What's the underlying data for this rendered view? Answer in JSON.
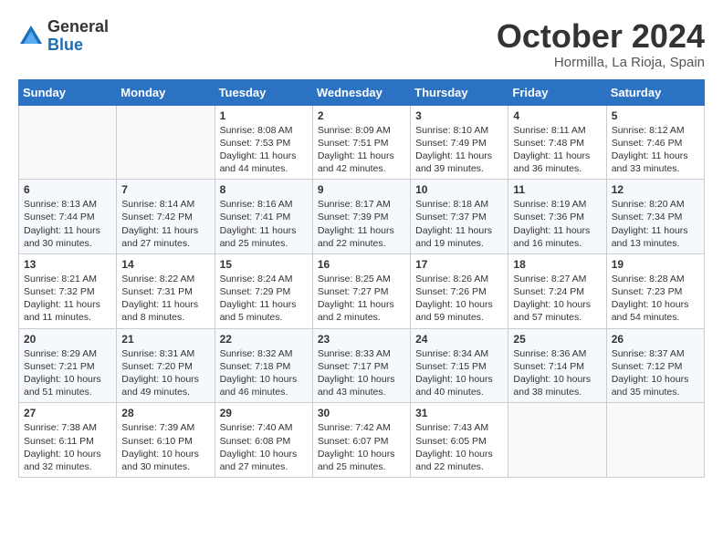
{
  "header": {
    "logo_general": "General",
    "logo_blue": "Blue",
    "month_title": "October 2024",
    "location": "Hormilla, La Rioja, Spain"
  },
  "days_of_week": [
    "Sunday",
    "Monday",
    "Tuesday",
    "Wednesday",
    "Thursday",
    "Friday",
    "Saturday"
  ],
  "weeks": [
    [
      {
        "day": "",
        "info": ""
      },
      {
        "day": "",
        "info": ""
      },
      {
        "day": "1",
        "info": "Sunrise: 8:08 AM\nSunset: 7:53 PM\nDaylight: 11 hours and 44 minutes."
      },
      {
        "day": "2",
        "info": "Sunrise: 8:09 AM\nSunset: 7:51 PM\nDaylight: 11 hours and 42 minutes."
      },
      {
        "day": "3",
        "info": "Sunrise: 8:10 AM\nSunset: 7:49 PM\nDaylight: 11 hours and 39 minutes."
      },
      {
        "day": "4",
        "info": "Sunrise: 8:11 AM\nSunset: 7:48 PM\nDaylight: 11 hours and 36 minutes."
      },
      {
        "day": "5",
        "info": "Sunrise: 8:12 AM\nSunset: 7:46 PM\nDaylight: 11 hours and 33 minutes."
      }
    ],
    [
      {
        "day": "6",
        "info": "Sunrise: 8:13 AM\nSunset: 7:44 PM\nDaylight: 11 hours and 30 minutes."
      },
      {
        "day": "7",
        "info": "Sunrise: 8:14 AM\nSunset: 7:42 PM\nDaylight: 11 hours and 27 minutes."
      },
      {
        "day": "8",
        "info": "Sunrise: 8:16 AM\nSunset: 7:41 PM\nDaylight: 11 hours and 25 minutes."
      },
      {
        "day": "9",
        "info": "Sunrise: 8:17 AM\nSunset: 7:39 PM\nDaylight: 11 hours and 22 minutes."
      },
      {
        "day": "10",
        "info": "Sunrise: 8:18 AM\nSunset: 7:37 PM\nDaylight: 11 hours and 19 minutes."
      },
      {
        "day": "11",
        "info": "Sunrise: 8:19 AM\nSunset: 7:36 PM\nDaylight: 11 hours and 16 minutes."
      },
      {
        "day": "12",
        "info": "Sunrise: 8:20 AM\nSunset: 7:34 PM\nDaylight: 11 hours and 13 minutes."
      }
    ],
    [
      {
        "day": "13",
        "info": "Sunrise: 8:21 AM\nSunset: 7:32 PM\nDaylight: 11 hours and 11 minutes."
      },
      {
        "day": "14",
        "info": "Sunrise: 8:22 AM\nSunset: 7:31 PM\nDaylight: 11 hours and 8 minutes."
      },
      {
        "day": "15",
        "info": "Sunrise: 8:24 AM\nSunset: 7:29 PM\nDaylight: 11 hours and 5 minutes."
      },
      {
        "day": "16",
        "info": "Sunrise: 8:25 AM\nSunset: 7:27 PM\nDaylight: 11 hours and 2 minutes."
      },
      {
        "day": "17",
        "info": "Sunrise: 8:26 AM\nSunset: 7:26 PM\nDaylight: 10 hours and 59 minutes."
      },
      {
        "day": "18",
        "info": "Sunrise: 8:27 AM\nSunset: 7:24 PM\nDaylight: 10 hours and 57 minutes."
      },
      {
        "day": "19",
        "info": "Sunrise: 8:28 AM\nSunset: 7:23 PM\nDaylight: 10 hours and 54 minutes."
      }
    ],
    [
      {
        "day": "20",
        "info": "Sunrise: 8:29 AM\nSunset: 7:21 PM\nDaylight: 10 hours and 51 minutes."
      },
      {
        "day": "21",
        "info": "Sunrise: 8:31 AM\nSunset: 7:20 PM\nDaylight: 10 hours and 49 minutes."
      },
      {
        "day": "22",
        "info": "Sunrise: 8:32 AM\nSunset: 7:18 PM\nDaylight: 10 hours and 46 minutes."
      },
      {
        "day": "23",
        "info": "Sunrise: 8:33 AM\nSunset: 7:17 PM\nDaylight: 10 hours and 43 minutes."
      },
      {
        "day": "24",
        "info": "Sunrise: 8:34 AM\nSunset: 7:15 PM\nDaylight: 10 hours and 40 minutes."
      },
      {
        "day": "25",
        "info": "Sunrise: 8:36 AM\nSunset: 7:14 PM\nDaylight: 10 hours and 38 minutes."
      },
      {
        "day": "26",
        "info": "Sunrise: 8:37 AM\nSunset: 7:12 PM\nDaylight: 10 hours and 35 minutes."
      }
    ],
    [
      {
        "day": "27",
        "info": "Sunrise: 7:38 AM\nSunset: 6:11 PM\nDaylight: 10 hours and 32 minutes."
      },
      {
        "day": "28",
        "info": "Sunrise: 7:39 AM\nSunset: 6:10 PM\nDaylight: 10 hours and 30 minutes."
      },
      {
        "day": "29",
        "info": "Sunrise: 7:40 AM\nSunset: 6:08 PM\nDaylight: 10 hours and 27 minutes."
      },
      {
        "day": "30",
        "info": "Sunrise: 7:42 AM\nSunset: 6:07 PM\nDaylight: 10 hours and 25 minutes."
      },
      {
        "day": "31",
        "info": "Sunrise: 7:43 AM\nSunset: 6:05 PM\nDaylight: 10 hours and 22 minutes."
      },
      {
        "day": "",
        "info": ""
      },
      {
        "day": "",
        "info": ""
      }
    ]
  ]
}
